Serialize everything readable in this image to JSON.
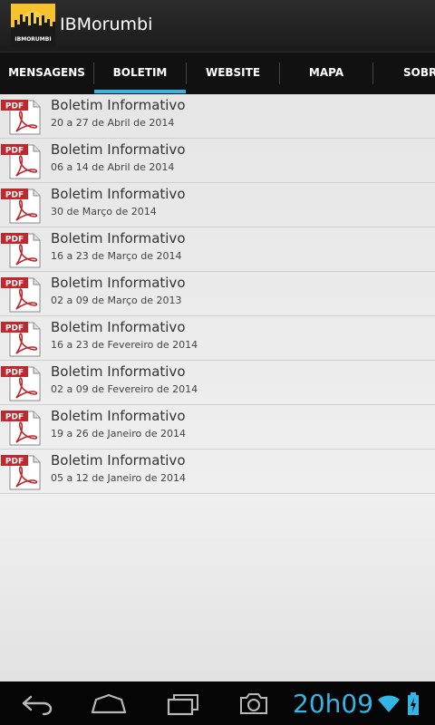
{
  "app": {
    "title": "IBMorumbi",
    "logo_text": "IBMORUMBI"
  },
  "tabs": [
    {
      "label": "MENSAGENS",
      "selected": false
    },
    {
      "label": "BOLETIM",
      "selected": true
    },
    {
      "label": "WEBSITE",
      "selected": false
    },
    {
      "label": "MAPA",
      "selected": false
    },
    {
      "label": "SOBRE",
      "selected": false
    }
  ],
  "items": [
    {
      "title": "Boletim Informativo",
      "subtitle": "20 a 27 de Abril de 2014",
      "icon": "pdf-icon"
    },
    {
      "title": "Boletim Informativo",
      "subtitle": "06 a 14 de Abril de 2014",
      "icon": "pdf-icon"
    },
    {
      "title": "Boletim Informativo",
      "subtitle": "30 de Março de 2014",
      "icon": "pdf-icon"
    },
    {
      "title": "Boletim Informativo",
      "subtitle": "16 a 23 de Março de 2014",
      "icon": "pdf-icon"
    },
    {
      "title": "Boletim Informativo",
      "subtitle": "02 a 09 de Março de 2013",
      "icon": "pdf-icon"
    },
    {
      "title": "Boletim Informativo",
      "subtitle": "16 a 23 de Fevereiro de 2014",
      "icon": "pdf-icon"
    },
    {
      "title": "Boletim Informativo",
      "subtitle": "02 a 09 de Fevereiro de 2014",
      "icon": "pdf-icon"
    },
    {
      "title": "Boletim Informativo",
      "subtitle": "19 a 26 de Janeiro de 2014",
      "icon": "pdf-icon"
    },
    {
      "title": "Boletim Informativo",
      "subtitle": "05 a 12 de Janeiro de 2014",
      "icon": "pdf-icon"
    }
  ],
  "icons": {
    "pdf_label": "PDF"
  },
  "navbar": {
    "back": "back-icon",
    "home": "home-icon",
    "recents": "recent-apps-icon",
    "screenshot": "camera-icon",
    "clock": "20h09"
  },
  "colors": {
    "accent": "#33b5e5",
    "pdf_red": "#c1272d"
  }
}
